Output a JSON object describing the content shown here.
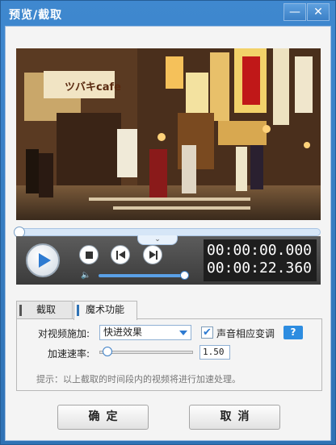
{
  "window": {
    "title": "预览/截取",
    "minimize_glyph": "—",
    "close_glyph": "✕"
  },
  "video": {
    "scene": "night street with illuminated shop signs",
    "sign_text": "ツバキcafe"
  },
  "player": {
    "seek_progress": 0.0,
    "volume_level": 0.95,
    "current_time": "00:00:00.000",
    "total_time": "00:00:22.360",
    "expand_glyph": "⌄",
    "volume_glyph": "🔈",
    "icons": [
      "play-icon",
      "stop-icon",
      "previous-frame-icon",
      "next-frame-icon",
      "volume-icon"
    ]
  },
  "tabs": [
    {
      "label": "截取",
      "selected": false
    },
    {
      "label": "魔术功能",
      "selected": true
    }
  ],
  "magic": {
    "effect_label": "对视频施加:",
    "effect_value": "快进效果",
    "pitch_label": "声音相应变调",
    "pitch_checked": true,
    "help_label": "?",
    "speed_label": "加速速率:",
    "speed_value": "1.50",
    "speed_slider_level": 0.1,
    "hint": "提示：以上截取的时间段内的视频将进行加速处理。"
  },
  "buttons": {
    "ok": "确定",
    "cancel": "取消"
  },
  "colors": {
    "accent": "#2d7ad1",
    "titlebar": "#3a82c8"
  }
}
